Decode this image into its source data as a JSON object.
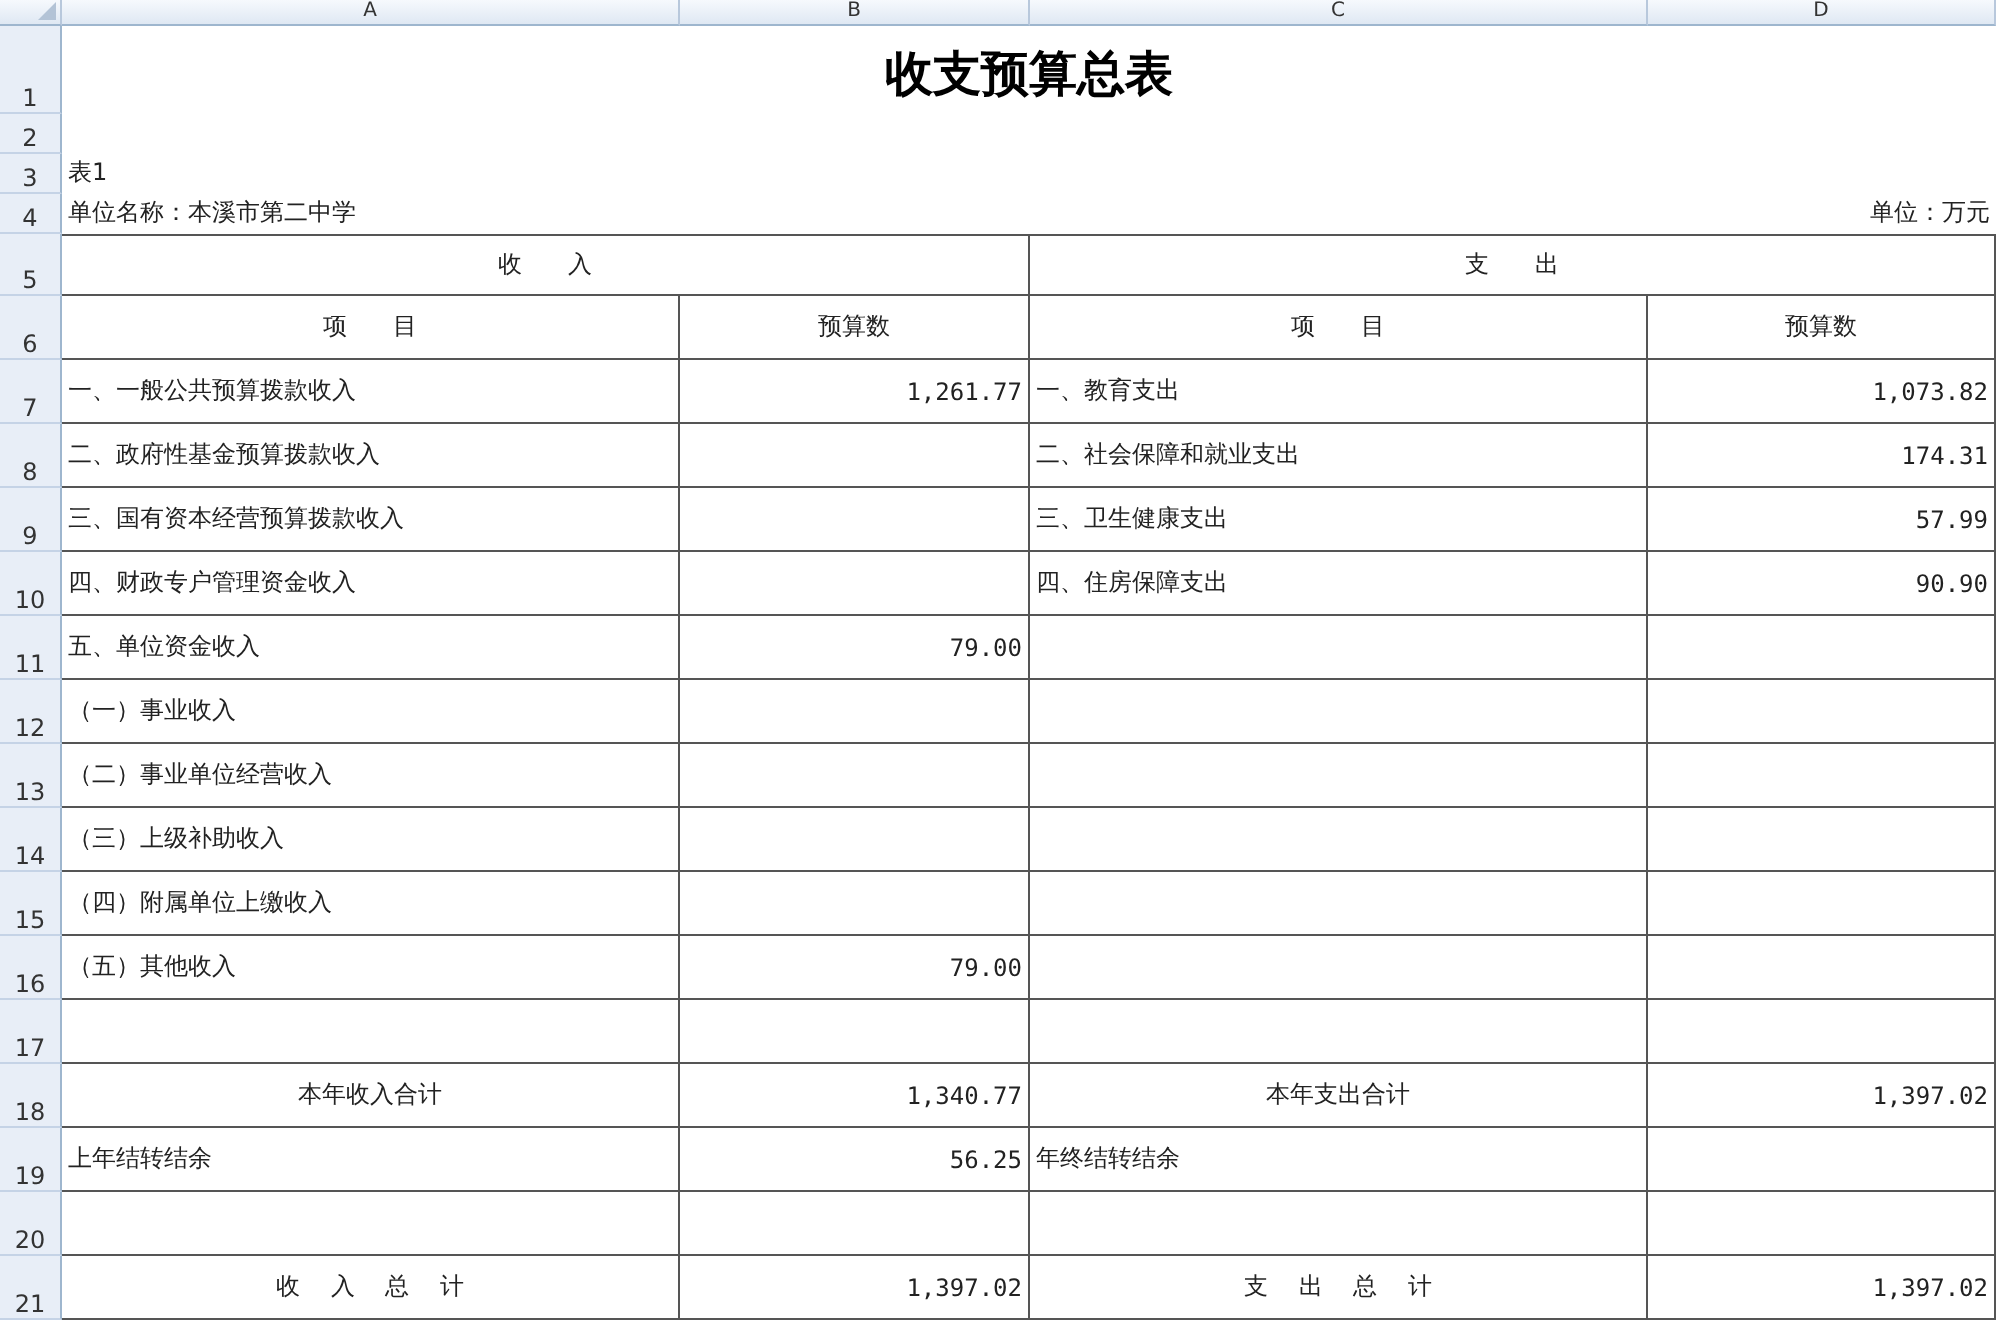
{
  "column_letters": [
    "A",
    "B",
    "C",
    "D"
  ],
  "row_numbers": [
    "1",
    "2",
    "3",
    "4",
    "5",
    "6",
    "7",
    "8",
    "9",
    "10",
    "11",
    "12",
    "13",
    "14",
    "15",
    "16",
    "17",
    "18",
    "19",
    "20",
    "21"
  ],
  "title": "收支预算总表",
  "table_label": "表1",
  "unit_name": "单位名称：本溪市第二中学",
  "unit": "单位：万元",
  "section_headers": [
    "收      入",
    "支      出"
  ],
  "column_headings": [
    "项      目",
    "预算数",
    "项      目",
    "预算数"
  ],
  "rows": [
    {
      "kind": "item",
      "income_item": "一、一般公共预算拨款收入",
      "income_amount": "1,261.77",
      "expense_item": "一、教育支出",
      "expense_amount": "1,073.82"
    },
    {
      "kind": "item",
      "income_item": "二、政府性基金预算拨款收入",
      "expense_item": "二、社会保障和就业支出",
      "expense_amount": "174.31"
    },
    {
      "kind": "item",
      "income_item": "三、国有资本经营预算拨款收入",
      "expense_item": "三、卫生健康支出",
      "expense_amount": "57.99"
    },
    {
      "kind": "item",
      "income_item": "四、财政专户管理资金收入",
      "expense_item": "四、住房保障支出",
      "expense_amount": "90.90"
    },
    {
      "kind": "item",
      "income_item": "五、单位资金收入",
      "income_amount": "79.00"
    },
    {
      "kind": "item",
      "income_item": "（一）事业收入"
    },
    {
      "kind": "item",
      "income_item": "（二）事业单位经营收入"
    },
    {
      "kind": "item",
      "income_item": "（三）上级补助收入"
    },
    {
      "kind": "item",
      "income_item": "（四）附属单位上缴收入"
    },
    {
      "kind": "item",
      "income_item": "（五）其他收入",
      "income_amount": "79.00"
    },
    {
      "kind": "item"
    },
    {
      "kind": "total",
      "income_item": "本年收入合计",
      "income_amount": "1,340.77",
      "expense_item": "本年支出合计",
      "expense_amount": "1,397.02"
    },
    {
      "kind": "item",
      "income_item": "上年结转结余",
      "income_amount": "56.25",
      "expense_item": "年终结转结余"
    },
    {
      "kind": "item"
    },
    {
      "kind": "total",
      "income_item": "收    入    总    计",
      "income_amount": "1,397.02",
      "expense_item": "支    出    总    计",
      "expense_amount": "1,397.02"
    }
  ]
}
